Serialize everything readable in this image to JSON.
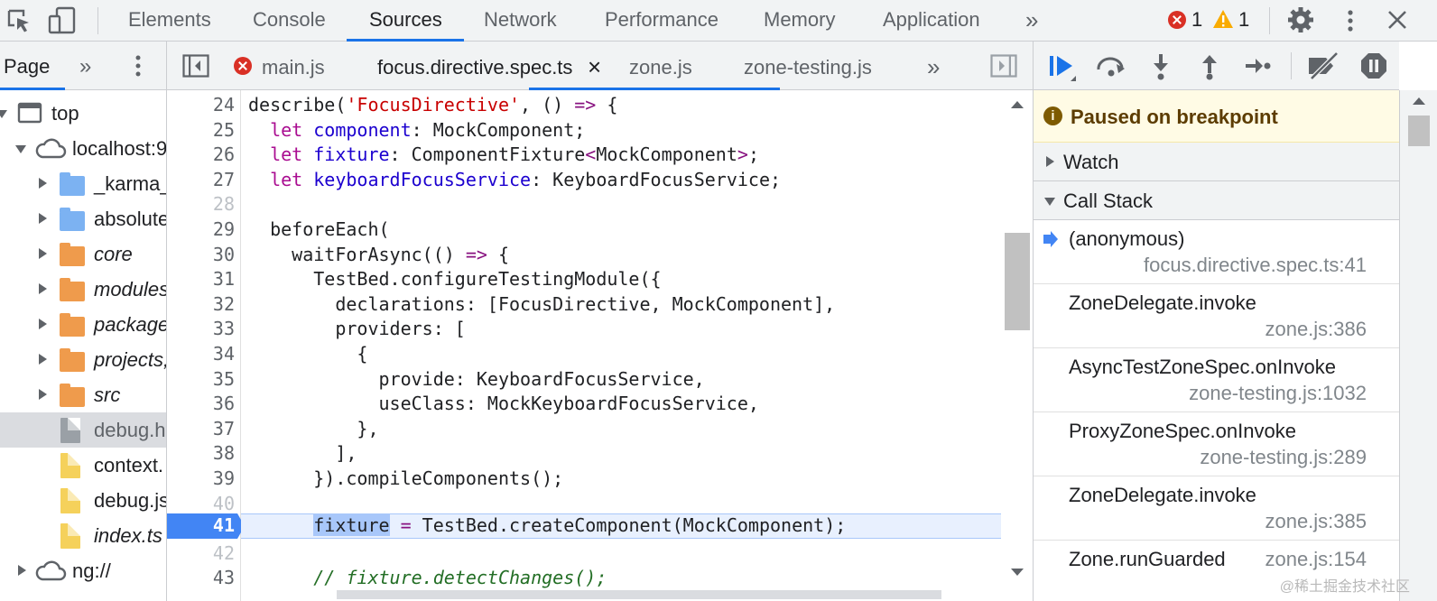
{
  "toolbar": {
    "tabs": [
      "Elements",
      "Console",
      "Sources",
      "Network",
      "Performance",
      "Memory",
      "Application"
    ],
    "active_tab": "Sources",
    "more_tabs": "»",
    "error_count": "1",
    "warning_count": "1"
  },
  "navigator": {
    "tab_label": "Page",
    "more": "»",
    "tree": [
      {
        "label": "top"
      },
      {
        "label": "localhost:9"
      },
      {
        "label": "_karma_"
      },
      {
        "label": "absolute"
      },
      {
        "label": "core"
      },
      {
        "label": "modules"
      },
      {
        "label": "package"
      },
      {
        "label": "projects,"
      },
      {
        "label": "src"
      },
      {
        "label": "debug.h"
      },
      {
        "label": "context."
      },
      {
        "label": "debug.js"
      },
      {
        "label": "index.ts"
      },
      {
        "label": "ng://"
      }
    ]
  },
  "editor": {
    "tabs": [
      "main.js",
      "focus.directive.spec.ts",
      "zone.js",
      "zone-testing.js"
    ],
    "active_tab": "focus.directive.spec.ts",
    "more": "»",
    "close_glyph": "×",
    "line_numbers": [
      "24",
      "25",
      "26",
      "27",
      "28",
      "29",
      "30",
      "31",
      "32",
      "33",
      "34",
      "35",
      "36",
      "37",
      "38",
      "39",
      "40",
      "41",
      "42",
      "43"
    ],
    "breakpoint_line": "41",
    "code": {
      "l24_a": "describe(",
      "l24_b": "'FocusDirective'",
      "l24_c": ", () ",
      "l24_d": "=>",
      "l24_e": " {",
      "l25_a": "  ",
      "l25_k": "let",
      "l25_v": " component",
      "l25_b": ": MockComponent;",
      "l26_a": "  ",
      "l26_k": "let",
      "l26_v": " fixture",
      "l26_b": ": ComponentFixture",
      "l26_c": "<",
      "l26_d": "MockComponent",
      "l26_e": ">",
      "l26_f": ";",
      "l27_a": "  ",
      "l27_k": "let",
      "l27_v": " keyboardFocusService",
      "l27_b": ": KeyboardFocusService;",
      "l29": "  beforeEach(",
      "l30_a": "    waitForAsync(() ",
      "l30_b": "=>",
      "l30_c": " {",
      "l31": "      TestBed.configureTestingModule({",
      "l32": "        declarations: [FocusDirective, MockComponent],",
      "l33": "        providers: [",
      "l34": "          {",
      "l35": "            provide: KeyboardFocusService,",
      "l36": "            useClass: MockKeyboardFocusService,",
      "l37": "          },",
      "l38": "        ],",
      "l39": "      }).compileComponents();",
      "l41_a": "      ",
      "l41_sel": "fixture",
      "l41_b": " ",
      "l41_eq": "=",
      "l41_c": " TestBed.createComponent(MockComponent);",
      "l43": "      // fixture.detectChanges();"
    }
  },
  "debugger": {
    "paused_message": "Paused on breakpoint",
    "info_glyph": "i",
    "watch_label": "Watch",
    "call_stack_label": "Call Stack",
    "frames": [
      {
        "fn": "(anonymous)",
        "loc": "focus.directive.spec.ts:41"
      },
      {
        "fn": "ZoneDelegate.invoke",
        "loc": "zone.js:386"
      },
      {
        "fn": "AsyncTestZoneSpec.onInvoke",
        "loc": "zone-testing.js:1032"
      },
      {
        "fn": "ProxyZoneSpec.onInvoke",
        "loc": "zone-testing.js:289"
      },
      {
        "fn": "ZoneDelegate.invoke",
        "loc": "zone.js:385"
      },
      {
        "fn": "Zone.runGuarded",
        "loc": "zone.js:154"
      }
    ]
  },
  "watermark": "@稀土掘金技术社区",
  "colors": {
    "accent": "#1a73e8",
    "error": "#d93025",
    "warning": "#f9ab00",
    "breakpoint": "#4285f4"
  }
}
